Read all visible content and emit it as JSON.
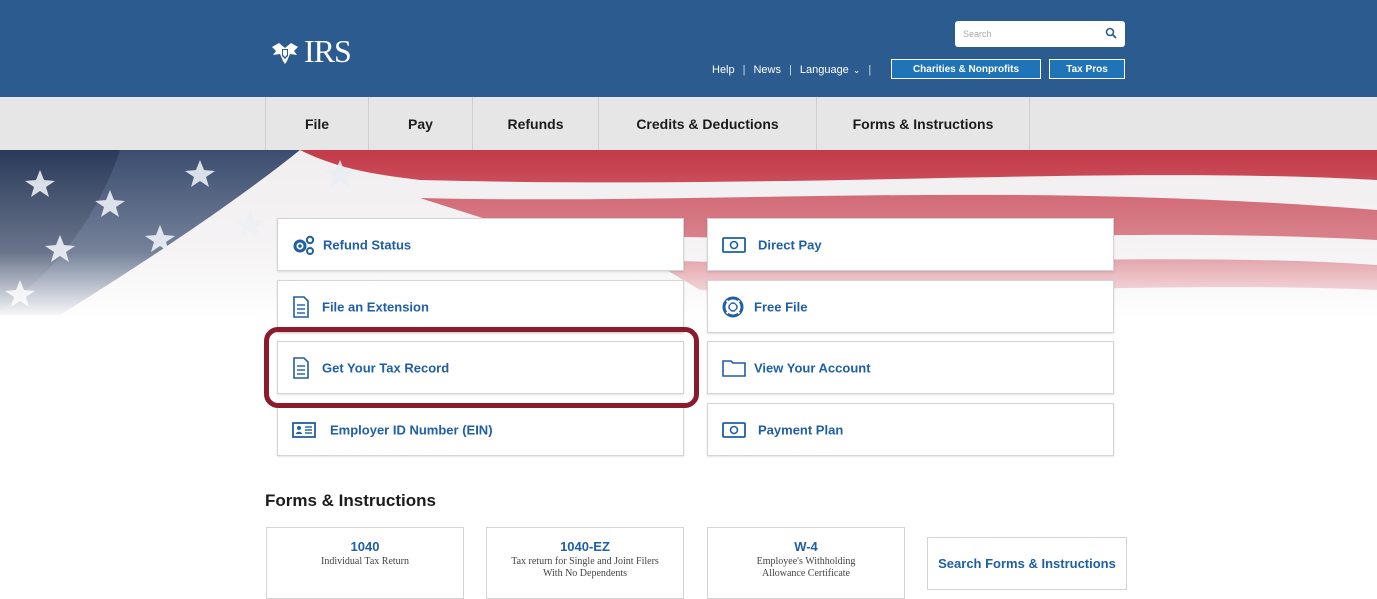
{
  "header": {
    "logo_text": "IRS",
    "search_placeholder": "Search",
    "util_links": {
      "help": "Help",
      "news": "News",
      "language": "Language",
      "sep": "|"
    },
    "buttons": {
      "charities": "Charities & Nonprofits",
      "taxpros": "Tax Pros"
    }
  },
  "nav": {
    "items": [
      "File",
      "Pay",
      "Refunds",
      "Credits & Deductions",
      "Forms & Instructions"
    ]
  },
  "tools": {
    "left": [
      "Refund Status",
      "File an Extension",
      "Get Your Tax Record",
      "Employer ID Number (EIN)"
    ],
    "right": [
      "Direct Pay",
      "Free File",
      "View Your Account",
      "Payment Plan"
    ]
  },
  "forms": {
    "title": "Forms & Instructions",
    "cards": [
      {
        "num": "1040",
        "desc": "Individual Tax Return"
      },
      {
        "num": "1040-EZ",
        "desc": "Tax return for Single and Joint Filers With No Dependents"
      },
      {
        "num": "W-4",
        "desc": "Employee's Withholding Allowance Certificate"
      }
    ],
    "search_label": "Search Forms & Instructions"
  },
  "colors": {
    "header_bg": "#2b5b8f",
    "nav_bg": "#e6e6e6",
    "link": "#1f5fa5",
    "highlight": "#8b1a2b"
  }
}
